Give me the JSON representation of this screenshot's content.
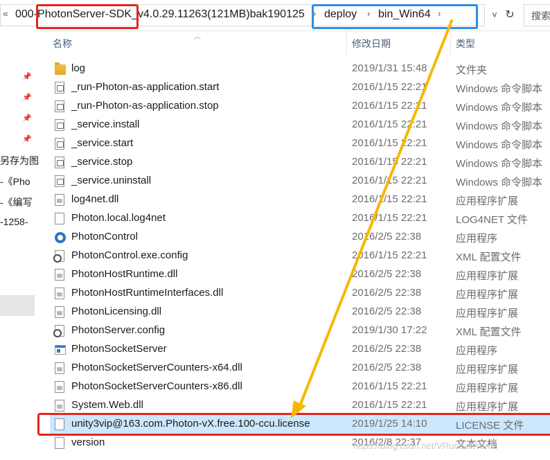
{
  "address_bar": {
    "overflow_label": "«",
    "path_segments": [
      "000-PhotonServer-SDK_v4.0.29.11263(121MB)bak190125",
      "deploy",
      "bin_Win64"
    ],
    "separator": "›",
    "dropdown_label": "˅",
    "refresh_label": "↻",
    "search_placeholder": "搜索"
  },
  "nav_pane": {
    "fragments": [
      "另存为图",
      "-《Pho",
      "-《编写",
      "-1258-"
    ]
  },
  "columns": {
    "name": "名称",
    "date": "修改日期",
    "type": "类型"
  },
  "files": [
    {
      "name": "log",
      "date": "2019/1/31 15:48",
      "type": "文件夹",
      "icon": "folder-icon"
    },
    {
      "name": "_run-Photon-as-application.start",
      "date": "2016/1/15 22:21",
      "type": "Windows 命令脚本",
      "icon": "script-icon"
    },
    {
      "name": "_run-Photon-as-application.stop",
      "date": "2016/1/15 22:21",
      "type": "Windows 命令脚本",
      "icon": "script-icon"
    },
    {
      "name": "_service.install",
      "date": "2016/1/15 22:21",
      "type": "Windows 命令脚本",
      "icon": "script-icon"
    },
    {
      "name": "_service.start",
      "date": "2016/1/15 22:21",
      "type": "Windows 命令脚本",
      "icon": "script-icon"
    },
    {
      "name": "_service.stop",
      "date": "2016/1/15 22:21",
      "type": "Windows 命令脚本",
      "icon": "script-icon"
    },
    {
      "name": "_service.uninstall",
      "date": "2016/1/15 22:21",
      "type": "Windows 命令脚本",
      "icon": "script-icon"
    },
    {
      "name": "log4net.dll",
      "date": "2016/1/15 22:21",
      "type": "应用程序扩展",
      "icon": "dll-icon"
    },
    {
      "name": "Photon.local.log4net",
      "date": "2016/1/15 22:21",
      "type": "LOG4NET 文件",
      "icon": "document-icon"
    },
    {
      "name": "PhotonControl",
      "date": "2016/2/5 22:38",
      "type": "应用程序",
      "icon": "photon-app-icon"
    },
    {
      "name": "PhotonControl.exe.config",
      "date": "2016/1/15 22:21",
      "type": "XML 配置文件",
      "icon": "config-icon"
    },
    {
      "name": "PhotonHostRuntime.dll",
      "date": "2016/2/5 22:38",
      "type": "应用程序扩展",
      "icon": "dll-icon"
    },
    {
      "name": "PhotonHostRuntimeInterfaces.dll",
      "date": "2016/2/5 22:38",
      "type": "应用程序扩展",
      "icon": "dll-icon"
    },
    {
      "name": "PhotonLicensing.dll",
      "date": "2016/2/5 22:38",
      "type": "应用程序扩展",
      "icon": "dll-icon"
    },
    {
      "name": "PhotonServer.config",
      "date": "2019/1/30 17:22",
      "type": "XML 配置文件",
      "icon": "config-icon"
    },
    {
      "name": "PhotonSocketServer",
      "date": "2016/2/5 22:38",
      "type": "应用程序",
      "icon": "app-icon"
    },
    {
      "name": "PhotonSocketServerCounters-x64.dll",
      "date": "2016/2/5 22:38",
      "type": "应用程序扩展",
      "icon": "dll-icon"
    },
    {
      "name": "PhotonSocketServerCounters-x86.dll",
      "date": "2016/1/15 22:21",
      "type": "应用程序扩展",
      "icon": "dll-icon"
    },
    {
      "name": "System.Web.dll",
      "date": "2016/1/15 22:21",
      "type": "应用程序扩展",
      "icon": "dll-icon"
    },
    {
      "name": "unity3vip@163.com.Photon-vX.free.100-ccu.license",
      "date": "2019/1/25 14:10",
      "type": "LICENSE 文件",
      "icon": "document-icon",
      "selected": true
    },
    {
      "name": "version",
      "date": "2016/2/8 22:37",
      "type": "文本文档",
      "icon": "document-icon"
    }
  ],
  "watermark": "https://blog.csdn.net/VRunSoftYanlz",
  "colors": {
    "highlight_red": "#e8231f",
    "highlight_blue": "#2b8fe6",
    "arrow_yellow": "#f5b800",
    "selected_row": "#cce8ff"
  }
}
